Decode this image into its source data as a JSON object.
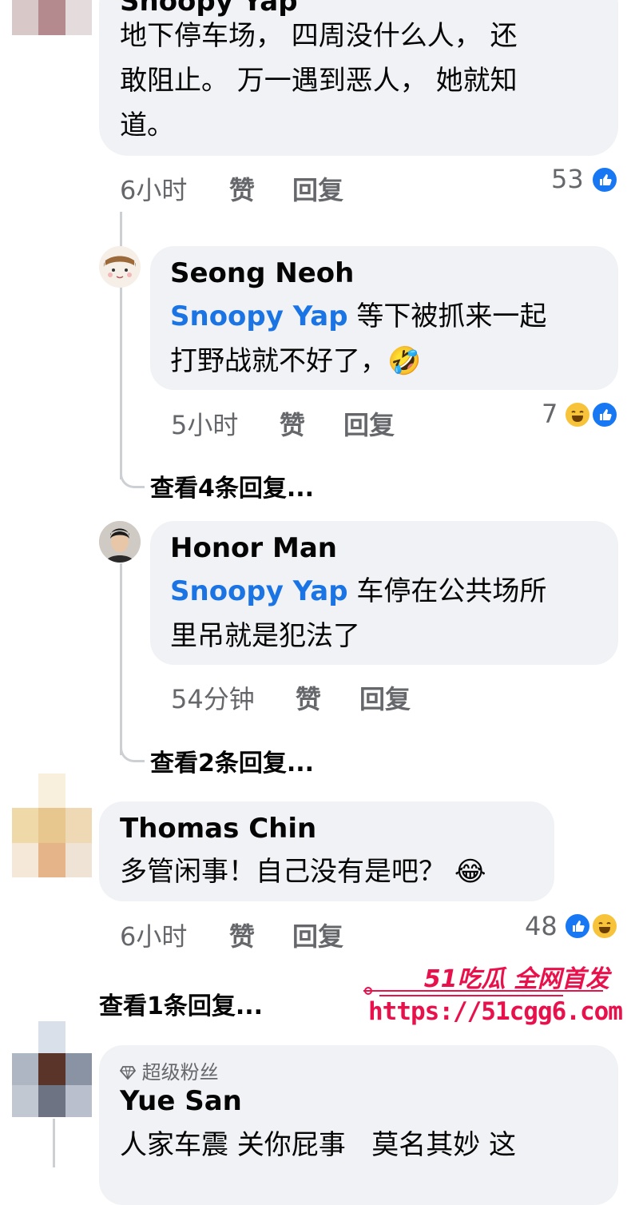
{
  "comments": [
    {
      "author": "Snoopy Yap",
      "text": "地下停车场， 四周没什么人， 还敢阻止。 万一遇到恶人， 她就知道。",
      "line1": "地下停车场， 四周没什么人， 还",
      "line2": "敢阻止。 万一遇到恶人， 她就知",
      "line3": "道。",
      "time": "6小时",
      "like_label": "赞",
      "reply_label": "回复",
      "reaction_count": "53",
      "reactions": [
        "like"
      ],
      "replies": [
        {
          "author": "Seong Neoh",
          "mention": "Snoopy Yap",
          "line1_rest": " 等下被抓来一起",
          "line2": "打野战就不好了，",
          "emoji": "🤣",
          "time": "5小时",
          "like_label": "赞",
          "reply_label": "回复",
          "reaction_count": "7",
          "reactions": [
            "haha",
            "like"
          ],
          "view_replies": "查看4条回复..."
        },
        {
          "author": "Honor Man",
          "mention": "Snoopy Yap",
          "line1_rest": " 车停在公共场所",
          "line2": "里吊就是犯法了",
          "time": "54分钟",
          "like_label": "赞",
          "reply_label": "回复",
          "view_replies": "查看2条回复..."
        }
      ]
    },
    {
      "author": "Thomas Chin",
      "text": "多管闲事！自己没有是吧？",
      "emoji": "😂",
      "time": "6小时",
      "like_label": "赞",
      "reply_label": "回复",
      "reaction_count": "48",
      "reactions": [
        "like",
        "haha"
      ],
      "view_replies": "查看1条回复..."
    },
    {
      "badge": "超级粉丝",
      "badge_icon": "diamond-icon",
      "author": "Yue San",
      "text": "人家车震 关你屁事   莫名其妙 这"
    }
  ],
  "watermark": {
    "brand": "51吃瓜 全网首发",
    "url": "https://51cgg6.com",
    "brand_color": "#e8114b"
  }
}
